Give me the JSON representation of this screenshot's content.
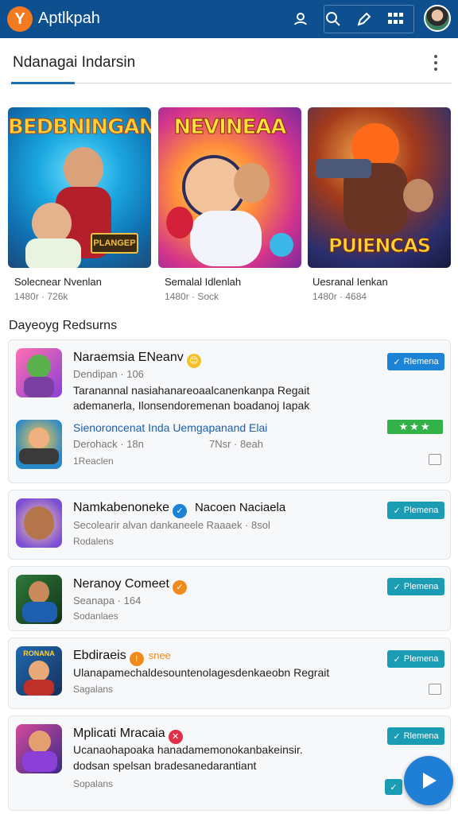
{
  "app_bar": {
    "logo_letter": "Y",
    "title": "Aptlkpah",
    "icons": [
      "user-icon",
      "search-icon",
      "tag-icon",
      "grid-icon",
      "avatar"
    ]
  },
  "section": {
    "title": "Ndanagai Indarsin"
  },
  "featured": [
    {
      "banner": "BEDBNINGAN",
      "label": "Solecnear Nvenlan",
      "meta": "1480r · 726k",
      "badge": "PLANGEP"
    },
    {
      "banner": "NEVINEAA",
      "label": "Semalal Idlenlah",
      "meta": "1480r · Sock"
    },
    {
      "banner": "PUIENCAS",
      "label": "Uesranal Ienkan",
      "meta": "1480r · 4684"
    }
  ],
  "list_heading": "Dayeoyg Redsurns",
  "cards": [
    {
      "title": "Naraemsia ENeanv",
      "title_emoji": "😊",
      "sub": "Dendipan · 106",
      "desc_1": "Taranannal nasiahanareoaalcanenkanpa Regait",
      "desc_2": "ademanerla, Ilonsendoremenan boadanoj Iapak",
      "button": "Rlemena",
      "sub_item": {
        "title": "Sienoroncenat Inda Uemgapanand Elai",
        "meta_left": "Derohack · 18n",
        "meta_right": "7Nsr · 8eah",
        "small": "1Reaclen",
        "rating": "★★★"
      }
    },
    {
      "title": "Namkabenoneke",
      "title_extra": "Nacoen Naciaela",
      "sub": "Secolearir alvan dankaneele Raaaek · 8sol",
      "small": "Rodalens",
      "button": "Plemena"
    },
    {
      "title": "Neranoy Comeet",
      "sub": "Seanapa · 164",
      "small": "Sodanlaes",
      "button": "Plemena"
    },
    {
      "title": "Ebdiraeis",
      "title_extra": "snee",
      "desc_1": "Ulanapamechaldesountenolagesdenkaeobn Regrait",
      "small": "Sagalans",
      "button": "Plemena"
    },
    {
      "title": "Mplicati Mracaia",
      "desc_1": "Ucanaohapoaka hanadamemonokanbakeinsir.",
      "desc_2": "dodsan spelsan bradesanedarantiant",
      "small": "Sopalans",
      "button": "Rlemena"
    }
  ],
  "colors": {
    "app_bar": "#0d4f8f",
    "accent": "#1d83d6",
    "teal_button": "#1a9db4",
    "rating_green": "#34b24a"
  }
}
